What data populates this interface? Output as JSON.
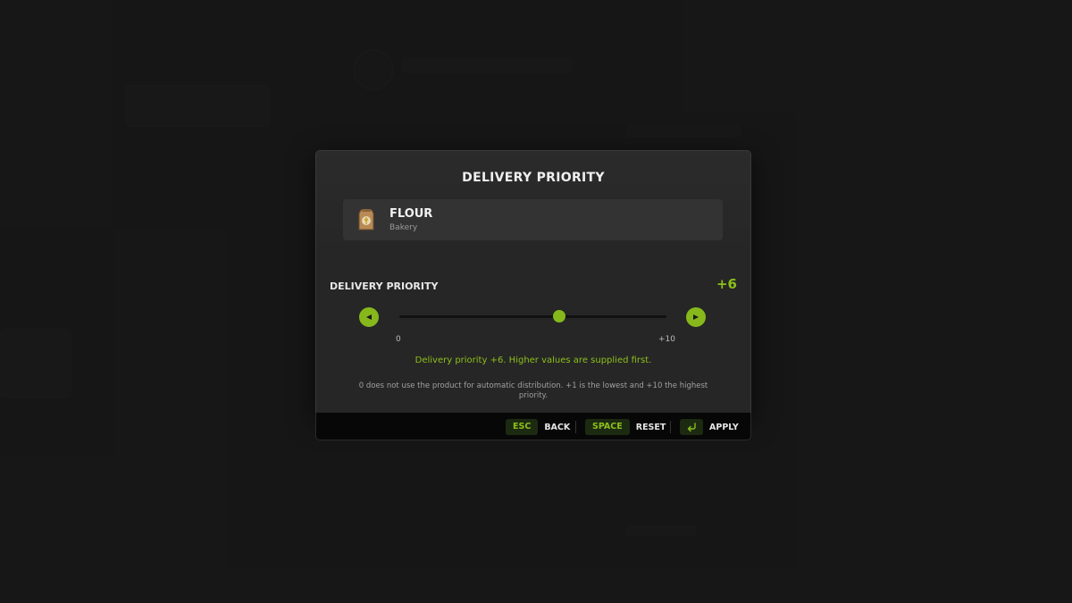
{
  "dialog": {
    "title": "DELIVERY PRIORITY",
    "product": {
      "name": "FLOUR",
      "category": "Bakery",
      "icon": "flour-sack-icon"
    },
    "priority": {
      "label": "DELIVERY PRIORITY",
      "value_text": "+6",
      "value": 6,
      "min": 0,
      "max": 10,
      "min_label": "0",
      "max_label": "+10"
    },
    "hint": "Delivery priority +6. Higher values are supplied first.",
    "note": "0 does not use the product for automatic distribution. +1 is the lowest and +10 the highest priority."
  },
  "footer": {
    "back": {
      "key": "ESC",
      "label": "BACK"
    },
    "reset": {
      "key": "SPACE",
      "label": "RESET"
    },
    "apply": {
      "key_icon": "enter-key-icon",
      "label": "APPLY"
    }
  },
  "colors": {
    "accent": "#86b81c",
    "accent_text": "#8cbf1a",
    "panel": "#262626",
    "footer": "#070707"
  }
}
